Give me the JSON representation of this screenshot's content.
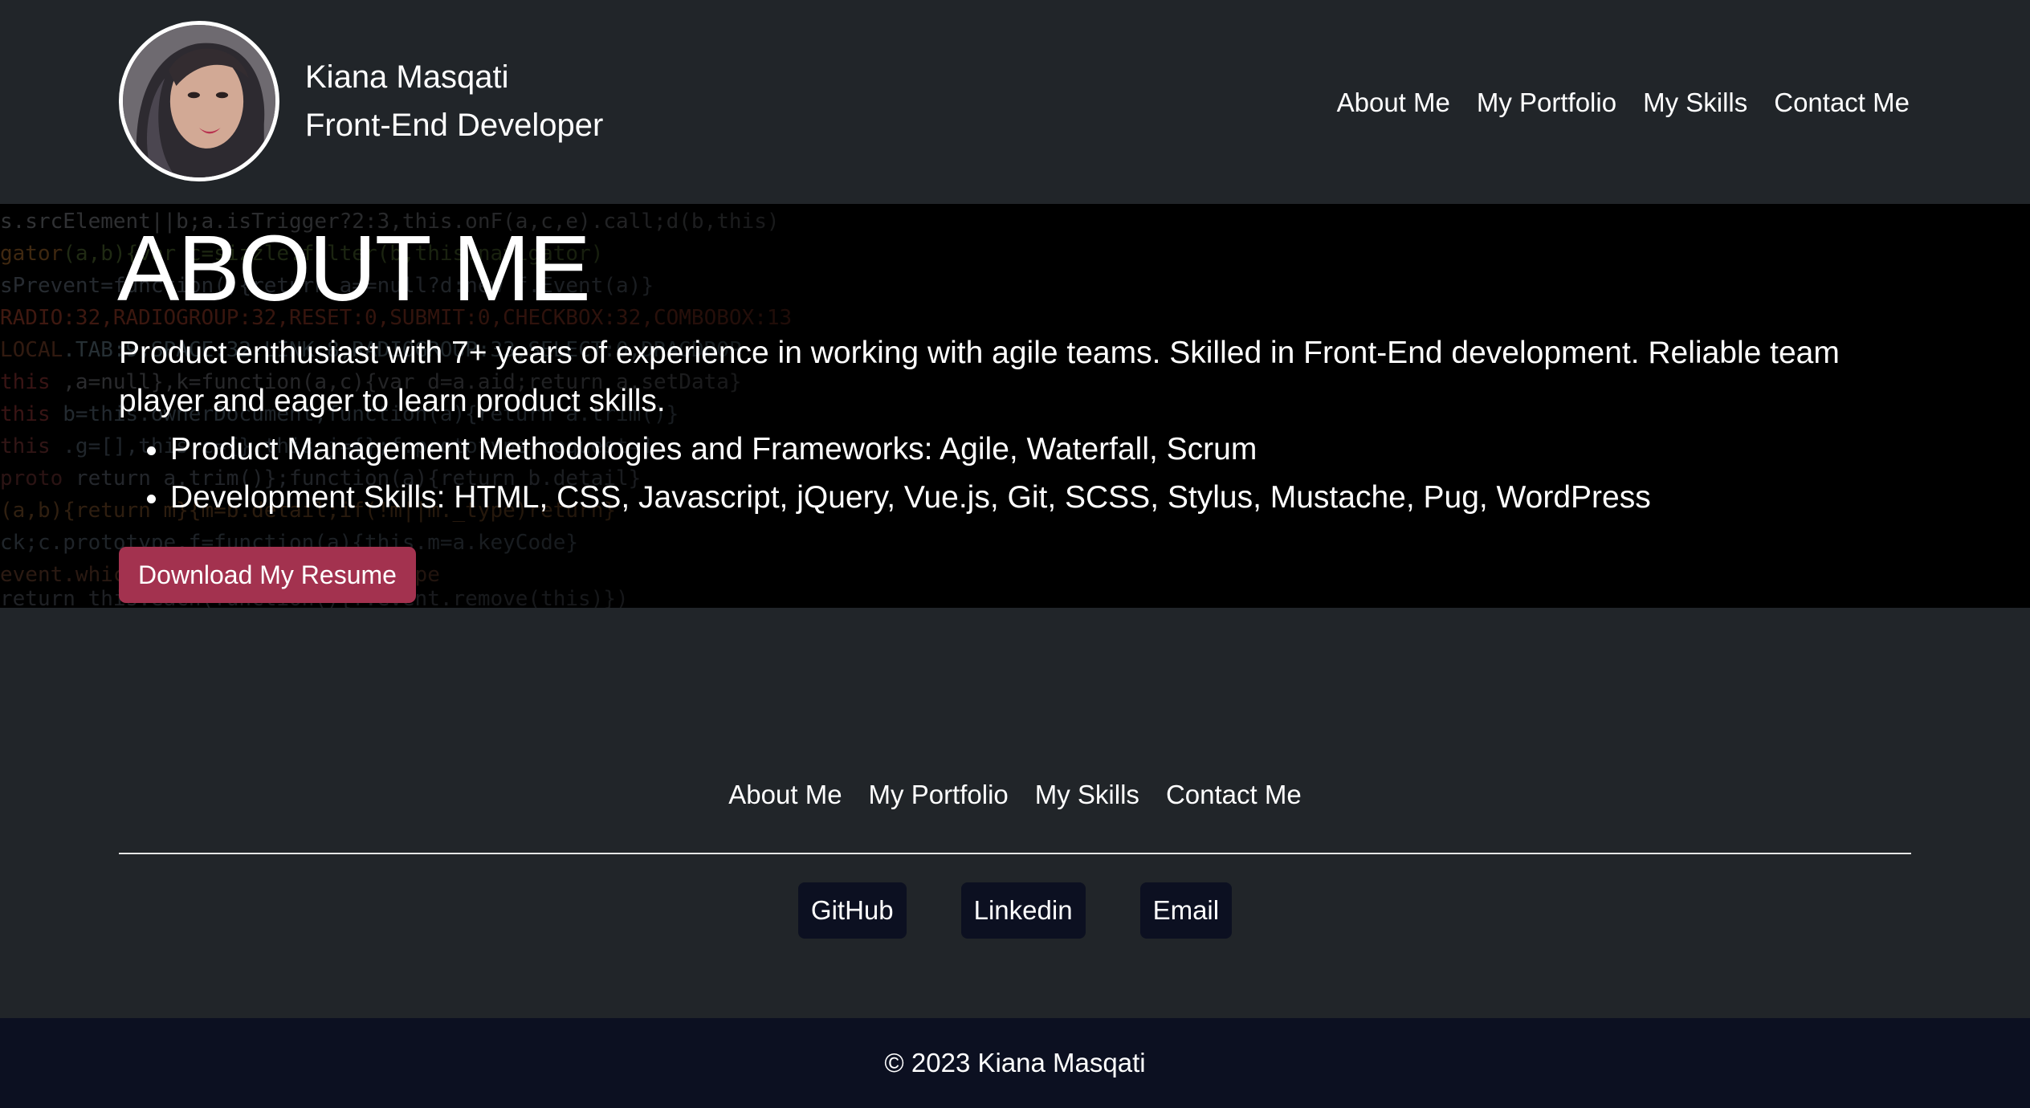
{
  "header": {
    "name": "Kiana Masqati",
    "title": "Front-End Developer",
    "nav": [
      "About Me",
      "My Portfolio",
      "My Skills",
      "Contact Me"
    ]
  },
  "hero": {
    "heading": "ABOUT ME",
    "intro": "Product enthusiast with 7+ years of experience in working with agile teams. Skilled in Front-End development. Reliable team player and eager to learn product skills.",
    "bullets": [
      "Product Management Methodologies and Frameworks: Agile, Waterfall, Scrum",
      "Development Skills: HTML, CSS, Javascript, jQuery, Vue.js, Git, SCSS, Stylus, Mustache, Pug, WordPress"
    ],
    "button_label": "Download My Resume"
  },
  "footer": {
    "nav": [
      "About Me",
      "My Portfolio",
      "My Skills",
      "Contact Me"
    ],
    "social": [
      "GitHub",
      "Linkedin",
      "Email"
    ],
    "copyright": "© 2023 Kiana Masqati"
  },
  "colors": {
    "page_bg": "#212529",
    "hero_bg": "#000000",
    "accent_button": "#a3324f",
    "footer_bar": "#0c1021",
    "social_button": "#0c1021"
  }
}
